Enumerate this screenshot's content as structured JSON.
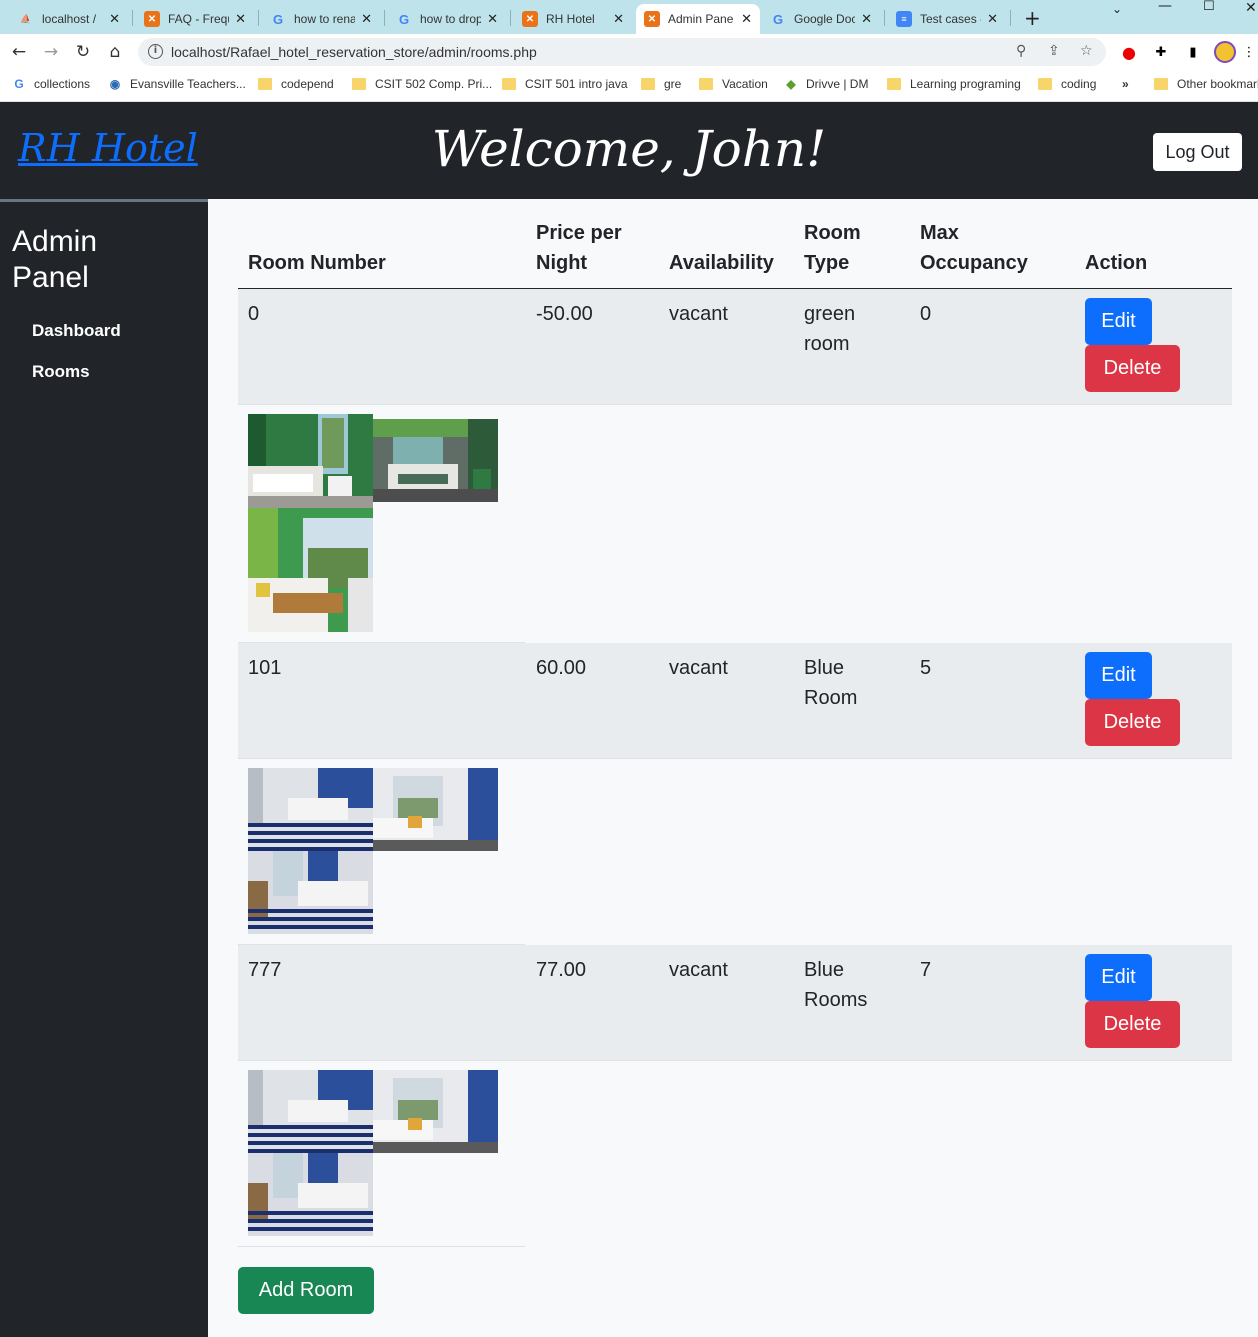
{
  "browser": {
    "tabs": [
      {
        "title": "localhost / ",
        "icon": "phpmyadmin-icon"
      },
      {
        "title": "FAQ - Frequ",
        "icon": "xampp-icon"
      },
      {
        "title": "how to rena",
        "icon": "google-icon"
      },
      {
        "title": "how to drop",
        "icon": "google-icon"
      },
      {
        "title": "RH Hotel",
        "icon": "xampp-icon"
      },
      {
        "title": "Admin Pane",
        "icon": "xampp-icon"
      },
      {
        "title": "Google Doc",
        "icon": "google-icon"
      },
      {
        "title": "Test cases -",
        "icon": "docs-icon"
      }
    ],
    "active_tab": 5,
    "url": "localhost/Rafael_hotel_reservation_store/admin/rooms.php",
    "bookmarks": [
      "collections",
      "Evansville Teachers...",
      "codepend",
      "CSIT 502 Comp. Pri...",
      "CSIT 501 intro java",
      "gre",
      "Vacation",
      "Drivve | DM",
      "Learning programing",
      "coding"
    ],
    "bookmarks_overflow": "»",
    "other_bookmarks": "Other bookmarks"
  },
  "header": {
    "brand": "RH Hotel",
    "welcome": "Welcome, John!",
    "logout_label": "Log Out"
  },
  "sidebar": {
    "title": "Admin Panel",
    "links": [
      "Dashboard",
      "Rooms"
    ]
  },
  "table": {
    "columns": [
      "Room Number",
      "Price per Night",
      "Availability",
      "Room Type",
      "Max Occupancy",
      "Action"
    ],
    "rows": [
      {
        "room_number": "0",
        "price": "-50.00",
        "availability": "vacant",
        "room_type": "green room",
        "max_occupancy": "0",
        "images": [
          "green-room-photo-1",
          "green-room-photo-2",
          "green-room-photo-3"
        ]
      },
      {
        "room_number": "101",
        "price": "60.00",
        "availability": "vacant",
        "room_type": "Blue Room",
        "max_occupancy": "5",
        "images": [
          "blue-room-photo-1",
          "blue-room-photo-2",
          "blue-room-photo-3"
        ]
      },
      {
        "room_number": "777",
        "price": "77.00",
        "availability": "vacant",
        "room_type": "Blue Rooms",
        "max_occupancy": "7",
        "images": [
          "blue-room-photo-1",
          "blue-room-photo-2",
          "blue-room-photo-3"
        ]
      }
    ],
    "edit_label": "Edit",
    "delete_label": "Delete"
  },
  "add_room_label": "Add Room",
  "colors": {
    "header_bg": "#212529",
    "page_bg": "#f8f9fa",
    "row_bg": "#e9ecef",
    "edit": "#0d6efd",
    "delete": "#dc3545",
    "add": "#198754"
  }
}
